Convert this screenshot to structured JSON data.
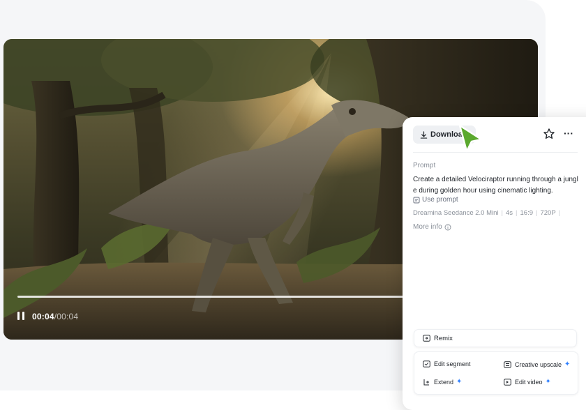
{
  "video": {
    "current_time": "00:04",
    "separator": "/",
    "total_time": "00:04",
    "progress": 1.0
  },
  "panel": {
    "download_label": "Download",
    "prompt_label": "Prompt",
    "prompt_text": "Create a detailed Velociraptor running through a jungle during golden hour using cinematic lighting.",
    "use_prompt_label": "Use prompt",
    "meta": {
      "model": "Dreamina Seedance 2.0 Mini",
      "duration": "4s",
      "ratio": "16:9",
      "resolution": "720P"
    },
    "more_info_label": "More info",
    "remix_label": "Remix",
    "tools": {
      "edit_segment": "Edit segment",
      "creative_upscale": "Creative upscale",
      "extend": "Extend",
      "edit_video": "Edit video"
    }
  },
  "icons": {
    "download": "download-icon",
    "star": "star-icon",
    "more": "more-icon",
    "use_prompt": "document-icon",
    "info": "info-icon",
    "remix": "remix-icon",
    "sparkle": "sparkle-icon"
  },
  "colors": {
    "accent_blue": "#2f80ff",
    "cursor_green": "#5aa82e"
  }
}
